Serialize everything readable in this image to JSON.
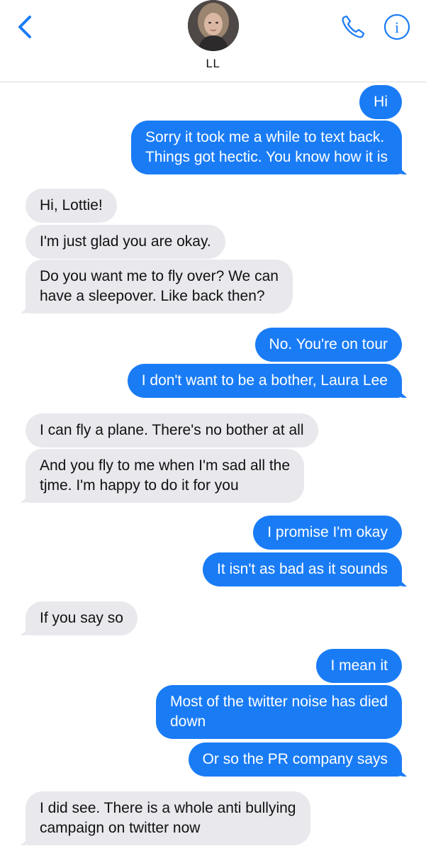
{
  "header": {
    "contact_name": "LL"
  },
  "colors": {
    "sent_bubble": "#1a7cf5",
    "received_bubble": "#e8e8ed",
    "accent": "#1a7cf5"
  },
  "icons": {
    "back": "chevron-left-icon",
    "call": "phone-icon",
    "info": "info-icon"
  },
  "messages": [
    {
      "from": "me",
      "text": "Hi"
    },
    {
      "from": "me",
      "lines": [
        "Sorry it took me a while to text back.",
        "Things got hectic. You know how it is"
      ]
    },
    {
      "from": "them",
      "text": "Hi, Lottie!"
    },
    {
      "from": "them",
      "text": "I'm just glad you are okay."
    },
    {
      "from": "them",
      "lines": [
        "Do you want me to fly over? We can",
        "have a sleepover. Like back then?"
      ]
    },
    {
      "from": "me",
      "text": "No. You're on tour"
    },
    {
      "from": "me",
      "text": "I don't want to be a bother, Laura Lee"
    },
    {
      "from": "them",
      "text": "I can fly a plane. There's no bother at all"
    },
    {
      "from": "them",
      "lines": [
        "And you fly to me when I'm sad all the",
        "tjme. I'm happy to do it for you"
      ]
    },
    {
      "from": "me",
      "text": "I promise I'm okay"
    },
    {
      "from": "me",
      "text": "It isn't as bad as it sounds"
    },
    {
      "from": "them",
      "text": "If you say so"
    },
    {
      "from": "me",
      "text": "I mean it"
    },
    {
      "from": "me",
      "lines": [
        "Most of the twitter noise has died",
        "down"
      ]
    },
    {
      "from": "me",
      "text": "Or so the PR company says"
    },
    {
      "from": "them",
      "lines": [
        "I did see. There is a whole anti bullying",
        "campaign on twitter now"
      ]
    }
  ]
}
